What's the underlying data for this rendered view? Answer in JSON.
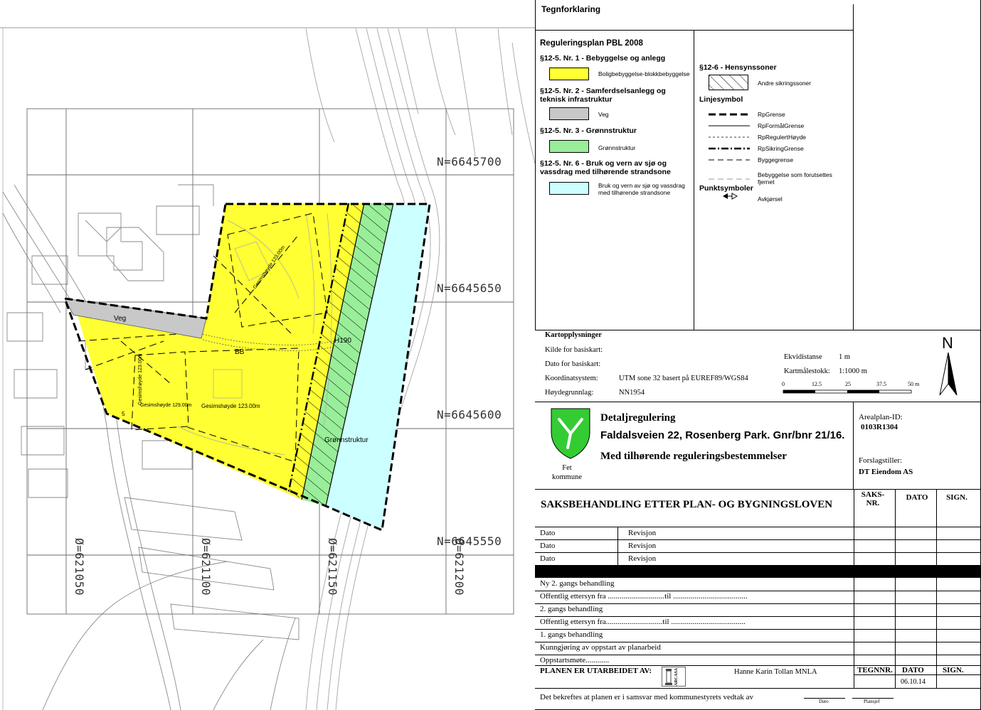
{
  "map": {
    "northings": [
      "N=6645700",
      "N=6645650",
      "N=6645600",
      "N=6645550"
    ],
    "eastings": [
      "Ø=621050",
      "Ø=621100",
      "Ø=621150",
      "Ø=621200"
    ],
    "labels": {
      "veg": "Veg",
      "bb": "BB",
      "h190": "H190",
      "gronnstruktur": "Grønnstruktur",
      "gesims1": "Gesimshøyde 123.00m",
      "gesims2": "Gesimshøyde 123.00m",
      "gesims3": "Gesimshøyde 123.00m",
      "gesims4": "Gesimshøyde 129.00m",
      "gesims5": "Gesimshøyde 123.00m",
      "num5": "5"
    },
    "overlap_text": "66"
  },
  "legend": {
    "title": "Tegnforklaring",
    "plan_title": "Reguleringsplan PBL 2008",
    "sec1": "§12-5. Nr. 1 - Bebyggelse og anlegg",
    "sec1_item": "Boligbebyggelse-blokkbebyggelse",
    "sec2": "§12-5. Nr. 2 - Samferdselsanlegg og teknisk infrastruktur",
    "sec2_item": "Veg",
    "sec3": "§12-5. Nr. 3 - Grønnstruktur",
    "sec3_item": "Grønnstruktur",
    "sec6": "§12-5. Nr. 6 - Bruk og vern av sjø og vassdrag med tilhørende strandsone",
    "sec6_item": "Bruk og vern av sjø og vassdrag med tilhørende strandsone",
    "hensyn": "§12-6 - Hensynssoner",
    "hensyn_item": "Andre sikringssoner",
    "linjesymbol": "Linjesymbol",
    "lines": [
      "RpGrense",
      "RpFormålGrense",
      "RpRegulertHøyde",
      "RpSikringGrense",
      "Byggegrense",
      "Bebyggelse som forutsettes fjernet"
    ],
    "punktsymboler": "Punktsymboler",
    "punkt_item": "Avkjørsel",
    "colors": {
      "yellow": "#ffff33",
      "grey": "#c8c8c8",
      "green": "#99ee99",
      "cyan": "#ccffff"
    }
  },
  "kart": {
    "title": "Kartopplysninger",
    "kilde": "Kilde for basiskart:",
    "dato": "Dato for basiskart:",
    "koord_label": "Koordinatsystem:",
    "koord_value": "UTM sone 32 basert på EUREF89/WGS84",
    "hoyde_label": "Høydegrunnlag:",
    "hoyde_value": "NN1954",
    "ekvi_label": "Ekvidistanse",
    "ekvi_value": "1 m",
    "malestokk_label": "Kartmålestokk:",
    "malestokk_value": "1:1000 m",
    "scale_ticks": [
      "0",
      "12.5",
      "25",
      "37.5",
      "50 m"
    ],
    "north": "N"
  },
  "title_block": {
    "kommune": "Fet\nkommune",
    "line1": "Detaljregulering",
    "line2": "Faldalsveien 22, Rosenberg Park. Gnr/bnr 21/16.",
    "line3": "Med tilhørende reguleringsbestemmelser",
    "arealplan_label": "Arealplan-ID:",
    "arealplan_value": "0103R1304",
    "forslag_label": "Forslagstiller:",
    "forslag_value": "DT Eiendom AS"
  },
  "saks": {
    "heading": "SAKSBEHANDLING ETTER PLAN- OG BYGNINGSLOVEN",
    "col_saks": "SAKS-\nNR.",
    "col_dato": "DATO",
    "col_sign": "SIGN.",
    "rev_rows": [
      {
        "a": "Dato",
        "b": "Revisjon"
      },
      {
        "a": "Dato",
        "b": "Revisjon"
      },
      {
        "a": "Dato",
        "b": "Revisjon"
      }
    ],
    "proc_rows": [
      "Ny 2. gangs behandling",
      "Offentlig ettersyn fra .............................til ......................................",
      "2. gangs behandling",
      "Offentlig ettersyn fra.............................til ......................................",
      "1. gangs behandling",
      "Kunngjøring av oppstart av planarbeid",
      "Oppstartsmøte............"
    ],
    "utarbeidet": "PLANEN ER UTARBEIDET AV:",
    "arcasa": "ARCASA",
    "author": "Hanne Karin Tollan MNLA",
    "tegnnr": "TEGNNR.",
    "dato": "DATO",
    "sign": "SIGN.",
    "date_value": "06.10.14",
    "bekreftes": "Det bekreftes at planen er i samsvar med kommunestyrets vedtak av",
    "foot_dato": "Dato",
    "foot_plansjef": "Plansjef"
  }
}
